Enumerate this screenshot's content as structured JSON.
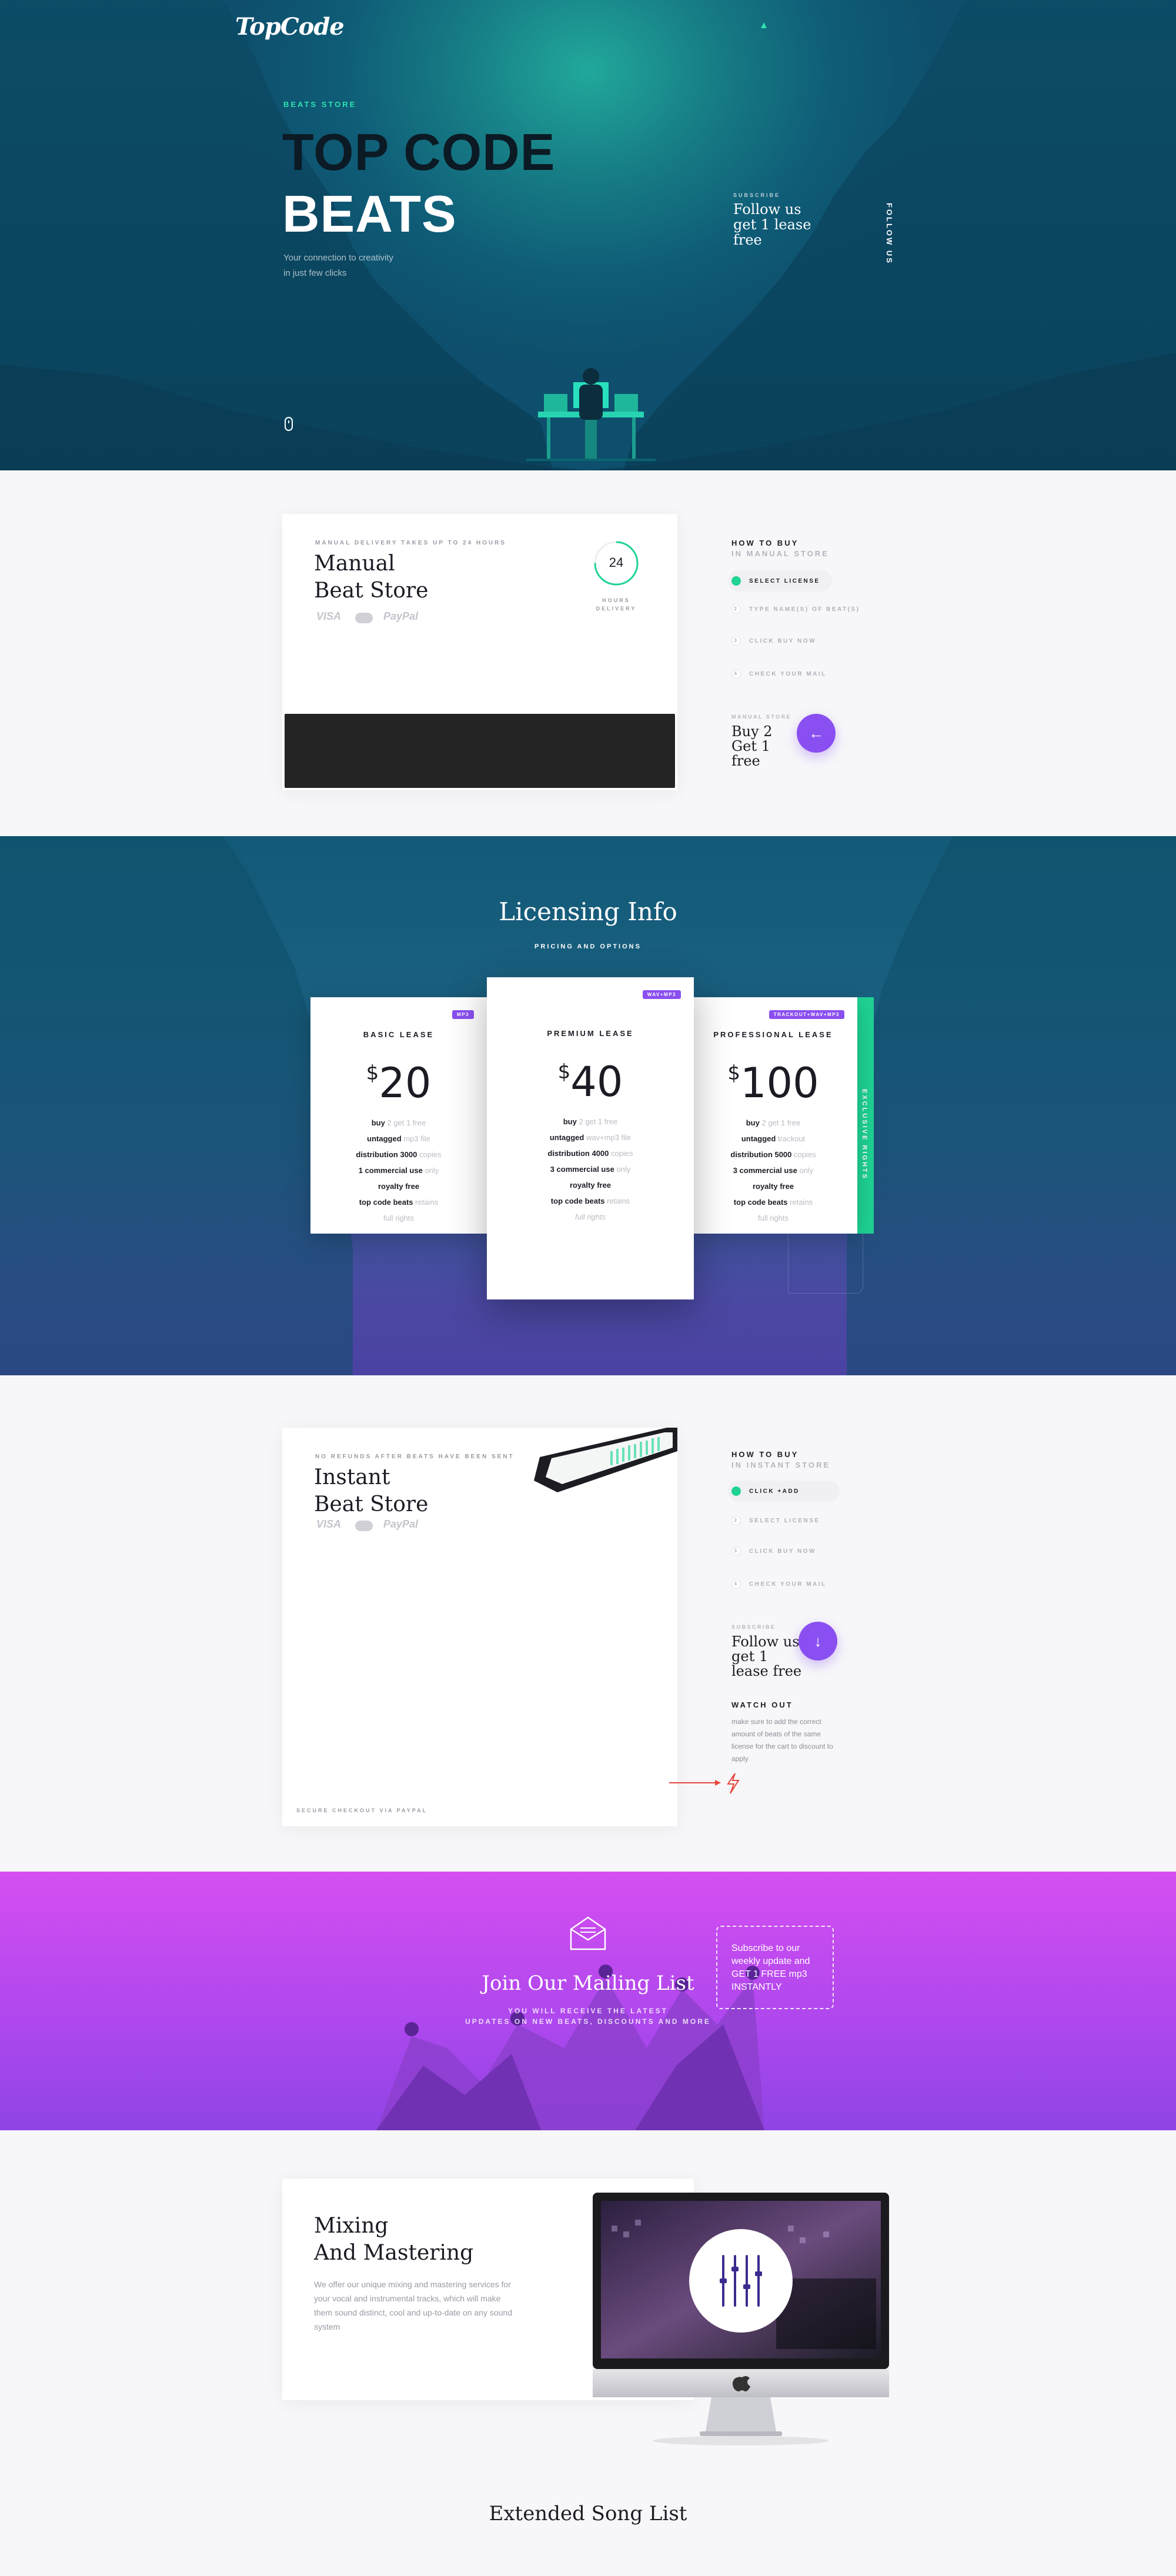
{
  "brand": {
    "logo": "TopCode"
  },
  "hero": {
    "kicker": "BEATS STORE",
    "title_line1": "TOP CODE",
    "title_line2": "BEATS",
    "subtitle_line1": "Your connection to creativity",
    "subtitle_line2": "in just few clicks",
    "subscribe_label": "SUBSCRIBE",
    "subscribe_text": "Follow us get 1 lease free",
    "follow_us": "FOLLOW US"
  },
  "manual_store": {
    "kicker": "MANUAL DELIVERY TAKES UP TO 24 HOURS",
    "title_line1": "Manual",
    "title_line2": "Beat Store",
    "payments": [
      "VISA",
      "MasterCard",
      "PayPal"
    ],
    "timer_value": "24",
    "timer_label_line1": "HOURS",
    "timer_label_line2": "DELIVERY",
    "howto_title": "HOW TO BUY",
    "howto_subtitle": "IN MANUAL STORE",
    "steps": [
      "SELECT LICENSE",
      "TYPE NAME(S) OF BEAT(S)",
      "CLICK BUY NOW",
      "CHECK YOUR MAIL"
    ],
    "step_numbers": [
      "",
      "2",
      "3",
      "4"
    ],
    "promo_label": "MANUAL STORE",
    "promo_text": "Buy 2 Get 1 free",
    "promo_icon": "arrow-left-icon"
  },
  "licensing": {
    "title": "Licensing Info",
    "subtitle": "PRICING AND OPTIONS",
    "plans": [
      {
        "badge": "MP3",
        "name": "BASIC LEASE",
        "currency": "$",
        "price": "20",
        "features": [
          {
            "b": "buy",
            "s": " 2 get 1 free"
          },
          {
            "b": "untagged",
            "s": " mp3 file"
          },
          {
            "b": "distribution 3000",
            "s": " copies"
          },
          {
            "b": "1 commercial use",
            "s": " only"
          },
          {
            "b": "royalty free",
            "s": ""
          },
          {
            "b": "top code beats",
            "s": " retains"
          },
          {
            "b": "",
            "s": "full rights"
          }
        ]
      },
      {
        "badge": "WAV+MP3",
        "name": "PREMIUM LEASE",
        "currency": "$",
        "price": "40",
        "features": [
          {
            "b": "buy",
            "s": " 2 get 1 free"
          },
          {
            "b": "untagged",
            "s": " wav+mp3 file"
          },
          {
            "b": "distribution 4000",
            "s": " copies"
          },
          {
            "b": "3 commercial use",
            "s": " only"
          },
          {
            "b": "royalty free",
            "s": ""
          },
          {
            "b": "top code beats",
            "s": " retains"
          },
          {
            "b": "",
            "s": "full rights"
          }
        ]
      },
      {
        "badge": "TRACKOUT+WAV+MP3",
        "name": "PROFESSIONAL LEASE",
        "currency": "$",
        "price": "100",
        "features": [
          {
            "b": "buy",
            "s": " 2 get 1 free"
          },
          {
            "b": "untagged",
            "s": " trackout"
          },
          {
            "b": "distribution 5000",
            "s": " copies"
          },
          {
            "b": "3 commercial use",
            "s": " only"
          },
          {
            "b": "royalty free",
            "s": ""
          },
          {
            "b": "top code beats",
            "s": " retains"
          },
          {
            "b": "",
            "s": "full rights"
          }
        ]
      }
    ],
    "exclusive_label": "EXCLUSIVE RIGHTS"
  },
  "instant_store": {
    "kicker": "NO REFUNDS AFTER BEATS HAVE BEEN SENT",
    "title_line1": "Instant",
    "title_line2": "Beat Store",
    "payments": [
      "VISA",
      "MasterCard",
      "PayPal"
    ],
    "footer": "SECURE CHECKOUT VIA PAYPAL",
    "howto_title": "HOW TO BUY",
    "howto_subtitle": "IN INSTANT STORE",
    "steps": [
      "CLICK +ADD",
      "SELECT LICENSE",
      "CLICK BUY NOW",
      "CHECK YOUR MAIL"
    ],
    "step_numbers": [
      "",
      "2",
      "3",
      "4"
    ],
    "promo_label": "SUBSCRIBE",
    "promo_text": "Follow us get 1 lease free",
    "promo_icon": "arrow-down-icon",
    "watch_title": "WATCH OUT",
    "watch_text": "make sure to add the correct amount of beats of the same license for the cart to discount to apply",
    "accent_color": "#8a4ff0",
    "warning_color": "#e8463b"
  },
  "mailing": {
    "title": "Join Our Mailing List",
    "subtitle_line1": "YOU WILL RECEIVE THE LATEST",
    "subtitle_line2": "UPDATES ON NEW BEATS, DISCOUNTS AND MORE",
    "bubble": "Subscribe to our weekly update and GET 1 FREE mp3 INSTANTLY",
    "icon": "envelope-icon"
  },
  "mixing": {
    "title_line1": "Mixing",
    "title_line2": "And Mastering",
    "description": "We offer our unique mixing and mastering services for your vocal and instrumental tracks, which will make them sound distinct, cool and up-to-date on any sound system"
  },
  "song_list": {
    "title": "Extended Song List"
  },
  "colors": {
    "accent_purple": "#8a4ff0",
    "accent_green": "#1fd394",
    "teal_bg": "#0f5c77",
    "mailing_bg": "#c34cf0"
  }
}
